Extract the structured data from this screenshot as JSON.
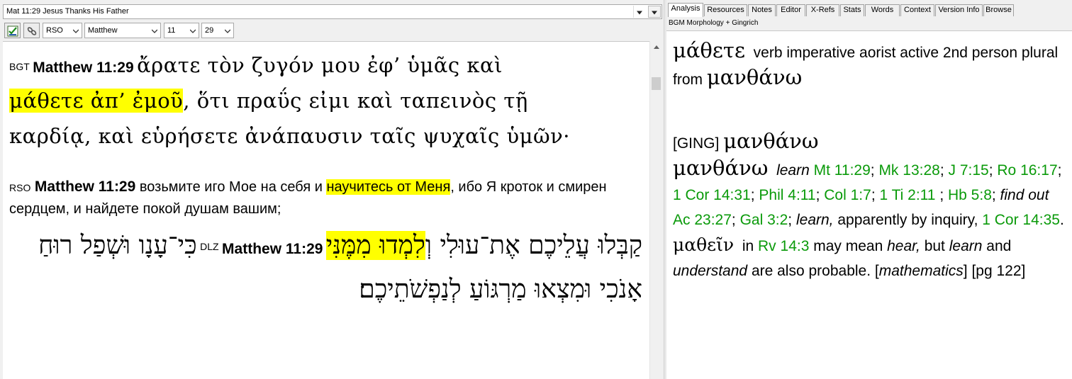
{
  "left": {
    "reference_title": "Mat 11:29 Jesus Thanks His Father",
    "toolbar": {
      "version": "RSO",
      "book": "Matthew",
      "chapter": "11",
      "verse": "29"
    },
    "verses": {
      "bgt": {
        "tag": "BGT",
        "ref": "Matthew 11:29",
        "line1": "ἄρατε τὸν ζυγόν μου ἐφ’ ὑμᾶς καὶ",
        "hl": "μάθετε ἀπ’ ἐμοῦ",
        "line2_rest": ", ὅτι πραΰς εἰμι καὶ ταπεινὸς τῇ",
        "line3": "καρδίᾳ, καὶ εὑρήσετε ἀνάπαυσιν ταῖς ψυχαῖς ὑμῶν·"
      },
      "rso": {
        "tag": "RSO",
        "ref": "Matthew 11:29",
        "pre": "возьмите иго Мое на себя и",
        "hl": "научитесь от Меня",
        "post": ", ибо Я кроток и смирен сердцем, и найдете покой душам вашим;"
      },
      "dlz": {
        "tag": "DLZ",
        "ref": "Matthew 11:29",
        "pre": "קַבְּלוּ עֲלֵיכֶם אֶת־עוּלִי וְ",
        "hl": "לִמְדוּ מִמֶּנִּי",
        "post": "כִּי־עָנָו וּשְׁפַל רוּחַ אָנֹכִי וּמִצְאוּ מַרְגּוֹעַ לְנַפְשֹׁתֵיכֶם׃"
      }
    }
  },
  "right": {
    "tabs": [
      "Analysis",
      "Resources",
      "Notes",
      "Editor",
      "X-Refs",
      "Stats",
      "Words",
      "Context",
      "Version Info",
      "Browse"
    ],
    "subtitle": "BGM Morphology + Gingrich",
    "analysis": {
      "word": "μάθετε",
      "parse": "verb imperative aorist active 2nd person plural from",
      "lemma": "μανθάνω",
      "ging_tag": "[GING]",
      "ging_word": "μανθάνω",
      "entry_word": "μανθάνω",
      "gloss1": "learn",
      "refs1": [
        "Mt 11:29",
        "Mk 13:28",
        "J 7:15",
        "Ro 16:17",
        "1 Cor 14:31",
        "Phil 4:11",
        "Col 1:7",
        "1 Ti 2:11",
        "Hb 5:8"
      ],
      "gloss2": "find out",
      "refs2": [
        "Ac 23:27",
        "Gal 3:2"
      ],
      "gloss3": "learn,",
      "text3": "apparently by inquiry,",
      "ref3": "1 Cor 14:35",
      "form": "μαθεῖν",
      "in_text": "in",
      "ref4": "Rv 14:3",
      "may_mean": "may mean",
      "hear": "hear,",
      "but": "but",
      "learn_it": "learn",
      "and": "and",
      "understand": "understand",
      "also": "are also probable. [",
      "mathematics": "mathematics",
      "pg": "] [pg 122]"
    }
  }
}
